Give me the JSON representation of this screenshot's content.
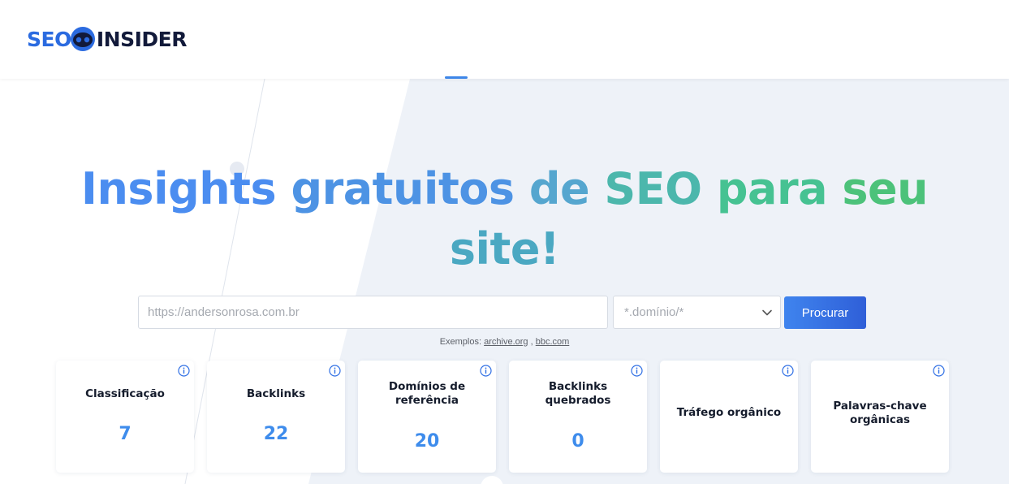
{
  "brand": {
    "logo_left": "SEO",
    "logo_right": "INSIDER"
  },
  "hero": {
    "words": [
      "Insights",
      "gratuitos",
      "de",
      "SEO",
      "para",
      "seu",
      "site!"
    ]
  },
  "search": {
    "url_placeholder": "https://andersonrosa.com.br",
    "mode_selected": "*.domínio/*",
    "button_label": "Procurar"
  },
  "examples": {
    "prefix": "Exemplos:",
    "links": [
      "archive.org",
      "bbc.com"
    ],
    "separator": ","
  },
  "cards": [
    {
      "title": "Classificação",
      "value": "7"
    },
    {
      "title": "Backlinks",
      "value": "22"
    },
    {
      "title": "Domínios de referência",
      "value": "20"
    },
    {
      "title": "Backlinks quebrados",
      "value": "0"
    },
    {
      "title": "Tráfego orgânico",
      "value": ""
    },
    {
      "title": "Palavras-chave orgânicas",
      "value": ""
    }
  ],
  "icons": {
    "info": "info-circle-icon",
    "chevron": "chevron-down-icon",
    "mascot": "mascot-face-icon"
  },
  "colors": {
    "accent": "#3e8cec",
    "button_start": "#3f84ee",
    "button_end": "#2f5fd8",
    "logo_blue": "#2b6be0",
    "logo_dark": "#121a3a",
    "gradient_green": "#4cc27a"
  }
}
